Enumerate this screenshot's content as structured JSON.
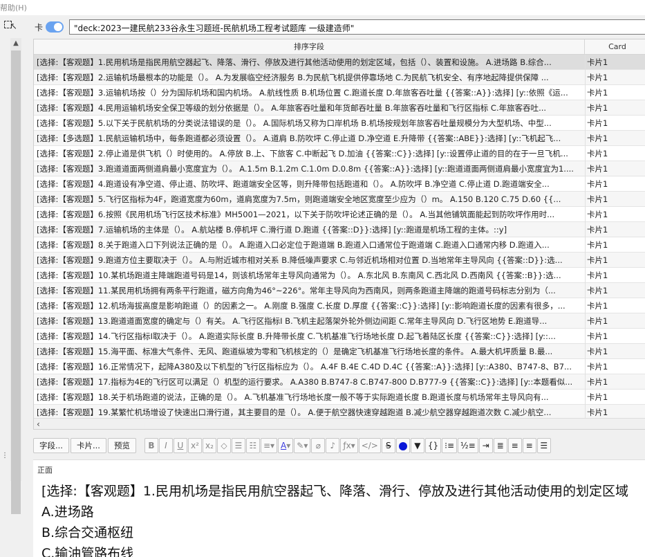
{
  "menubar": {
    "help_label": "帮助(H)"
  },
  "toggle": {
    "label": "卡"
  },
  "search": {
    "value": "\"deck:2023一建民航233谷永生习题班-民航机场工程考试题库 一级建造师\""
  },
  "table": {
    "headers": {
      "sort_field": "排序字段",
      "card": "Card"
    },
    "rows": [
      {
        "sort_field": "[选择:【客观题】1.民用机场是指民用航空器起飞、降落、滑行、停放及进行其他活动使用的划定区域，包括（）、装置和设施。 A.进场路 B.综合...",
        "card": "卡片1",
        "selected": true
      },
      {
        "sort_field": "[选择:【客观题】2.运输机场最根本的功能是（）。 A.为发展临空经济服务 B.为民航飞机提供停靠场地 C.为民航飞机安全、有序地起降提供保障 ...",
        "card": "卡片1"
      },
      {
        "sort_field": "[选择:【客观题】3.运输机场按（）分为国际机场和国内机场。 A.航线性质 B.机场位置 C.跑道长度 D.年旅客吞吐量 {{答案::A}}:选择] [y::依照《运...",
        "card": "卡片1"
      },
      {
        "sort_field": "[选择:【客观题】4.民用运输机场安全保卫等级的划分依据是（）。 A.年旅客吞吐量和年货邮吞吐量 B.年旅客吞吐量和飞行区指标 C.年旅客吞吐...",
        "card": "卡片1"
      },
      {
        "sort_field": "[选择:【客观题】5.以下关于民航机场的分类说法错误的是（）。 A.国际机场又称为口岸机场 B.机场按规划年旅客吞吐量规模分为大型机场、中型...",
        "card": "卡片1"
      },
      {
        "sort_field": "[选择:【多选题】1.民航运输机场中，每条跑道都必须设置（）。 A.道肩 B.防吹坪 C.停止道 D.净空道 E.升降带 {{答案::ABE}}:选择] [y::飞机起飞...",
        "card": "卡片1"
      },
      {
        "sort_field": "[选择:【客观题】2.停止道是供飞机（）时使用的。 A.停放 B.上、下旅客 C.中断起飞 D.加油 {{答案::C}}:选择] [y::设置停止道的目的在于一旦飞机...",
        "card": "卡片1"
      },
      {
        "sort_field": "[选择:【客观题】3.跑道道面两侧道肩最小宽度宜为（）。 A.1.5m B.1.2m C.1.0m D.0.8m {{答案::A}}:选择] [y::跑道道面两侧道肩最小宽度宜为1....",
        "card": "卡片1"
      },
      {
        "sort_field": "[选择:【客观题】4.跑道设有净空道、停止道、防吹坪、跑道端安全区等，则升降带包括跑道和（）。 A.防吹坪 B.净空道 C.停止道 D.跑道端安全...",
        "card": "卡片1"
      },
      {
        "sort_field": "[选择:【客观题】5.飞行区指标为4F，跑道宽度为60m，道肩宽度为7.5m，则跑道端安全地区宽度至少应为（）m。 A.150 B.120 C.75 D.60 {{...",
        "card": "卡片1"
      },
      {
        "sort_field": "[选择:【客观题】6.按照《民用机场飞行区技术标准》MH5001—2021，以下关于防吹坪论述正确的是（）。 A.当其他铺筑面能起到防吹坪作用时...",
        "card": "卡片1"
      },
      {
        "sort_field": "[选择:【客观题】7.运输机场的主体是（）。 A.航站楼 B.停机坪 C.滑行道 D.跑道 {{答案::D}}:选择] [y::跑道是机场工程的主体。::y]",
        "card": "卡片1"
      },
      {
        "sort_field": "[选择:【客观题】8.关于跑道入口下列说法正确的是（）。 A.跑道入口必定位于跑道端 B.跑道入口通常位于跑道端 C.跑道入口通常内移 D.跑道入...",
        "card": "卡片1"
      },
      {
        "sort_field": "[选择:【客观题】9.跑道方位主要取决于（）。 A.与附近城市相对关系 B.降低噪声要求 C.与邻近机场相对位置 D.当地常年主导风向 {{答案::D}}:选...",
        "card": "卡片1"
      },
      {
        "sort_field": "[选择:【客观题】10.某机场跑道主降端跑道号码是14，则该机场常年主导风向通常为（）。 A.东北风 B.东南风 C.西北风 D.西南风 {{答案::B}}:选...",
        "card": "卡片1"
      },
      {
        "sort_field": "[选择:【客观题】11.某民用机场拥有两条平行跑道，磁方向角为46°~226°。常年主导风向为西南风，则两条跑道主降端的跑道号码标志分别为（...",
        "card": "卡片1"
      },
      {
        "sort_field": "[选择:【客观题】12.机场海拔高度是影响跑道（）的因素之一。 A.刚度 B.强度 C.长度 D.厚度 {{答案::C}}:选择] [y::影响跑道长度的因素有很多，...",
        "card": "卡片1"
      },
      {
        "sort_field": "[选择:【客观题】13.跑道道面宽度的确定与（）有关。 A.飞行区指标Ⅰ B.飞机主起落架外轮外侧边间距 C.常年主导风向 D.飞行区地势 E.跑道导...",
        "card": "卡片1"
      },
      {
        "sort_field": "[选择:【客观题】14.飞行区指标Ⅰ取决于（）。 A.跑道实际长度 B.升降带长度 C.飞机基准飞行场地长度 D.起飞着陆区长度 {{答案::C}}:选择] [y::...",
        "card": "卡片1"
      },
      {
        "sort_field": "[选择:【客观题】15.海平面、标准大气条件、无风、跑道纵坡为零和飞机核定的（）是确定飞机基准飞行场地长度的条件。 A.最大机坪质量 B.最...",
        "card": "卡片1"
      },
      {
        "sort_field": "[选择:【客观题】16.正常情况下，起降A380及以下机型的飞行区指标应为（）。 A.4F B.4E C.4D D.4C {{答案::A}}:选择] [y::A380、B747-8、B7...",
        "card": "卡片1"
      },
      {
        "sort_field": "[选择:【客观题】17.指标为4E的飞行区可以满足（）机型的运行要求。 A.A380 B.B747-8 C.B747-800 D.B777-9 {{答案::C}}:选择] [y::本题看似...",
        "card": "卡片1"
      },
      {
        "sort_field": "[选择:【客观题】18.关于机场跑道的说法，正确的是（）。 A.飞机基准飞行场地长度一般不等于实际跑道长度 B.跑道长度与机场常年主导风向有...",
        "card": "卡片1"
      },
      {
        "sort_field": "[选择:【客观题】19.某繁忙机场增设了快速出口滑行道，其主要目的是（）。 A.便于航空器快速穿越跑道 B.减少航空器穿越跑道次数 C.减少航空...",
        "card": "卡片1"
      }
    ]
  },
  "toolbar": {
    "fields_label": "字段...",
    "cards_label": "卡片...",
    "preview_label": "预览",
    "icons": [
      "bold-icon",
      "italic-icon",
      "underline-icon",
      "superscript-icon",
      "subscript-icon",
      "eraser-icon",
      "bullet-list-icon",
      "numbered-list-icon",
      "align-icon",
      "text-color-icon",
      "highlight-icon",
      "attach-icon",
      "record-icon",
      "formula-icon",
      "html-icon",
      "strikethrough-icon",
      "color-dot-icon",
      "triangle-icon",
      "braces-icon",
      "list-a-icon",
      "list-b-icon",
      "indent-icon",
      "align-center-icon",
      "align-left-icon",
      "align-right-icon",
      "justify-icon"
    ],
    "accent_color": "#0a17d8"
  },
  "editor": {
    "field_name": "正面",
    "lines": [
      "[选择:【客观题】1.民用机场是指民用航空器起飞、降落、滑行、停放及进行其他活动使用的划定区域",
      "A.进场路",
      "B.综合交通枢纽",
      "C.输油管路布线"
    ]
  }
}
